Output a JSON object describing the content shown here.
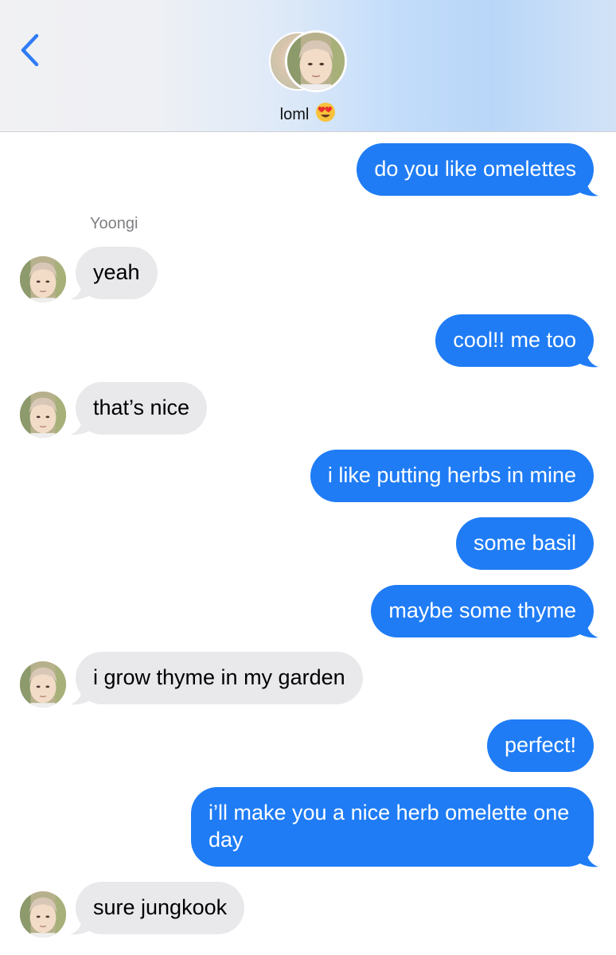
{
  "header": {
    "back_icon": "chevron-left-icon",
    "contact_name": "loml",
    "contact_emoji": "heart-eyes-emoji",
    "accent": "#2f7cf6"
  },
  "sender_name": "Yoongi",
  "colors": {
    "outgoing": "#1f7cf5",
    "incoming": "#e9e9ec"
  },
  "messages": [
    {
      "dir": "out",
      "text": "do you like omelettes"
    },
    {
      "dir": "in",
      "text": "yeah"
    },
    {
      "dir": "out",
      "text": "cool!! me too"
    },
    {
      "dir": "in",
      "text": "that’s nice"
    },
    {
      "dir": "out",
      "text": "i like putting herbs in mine"
    },
    {
      "dir": "out",
      "text": "some basil"
    },
    {
      "dir": "out",
      "text": "maybe some thyme"
    },
    {
      "dir": "in",
      "text": "i grow thyme in my garden"
    },
    {
      "dir": "out",
      "text": "perfect!"
    },
    {
      "dir": "out",
      "text": "i’ll make you a nice herb omelette one day"
    },
    {
      "dir": "in",
      "text": "sure jungkook"
    }
  ]
}
